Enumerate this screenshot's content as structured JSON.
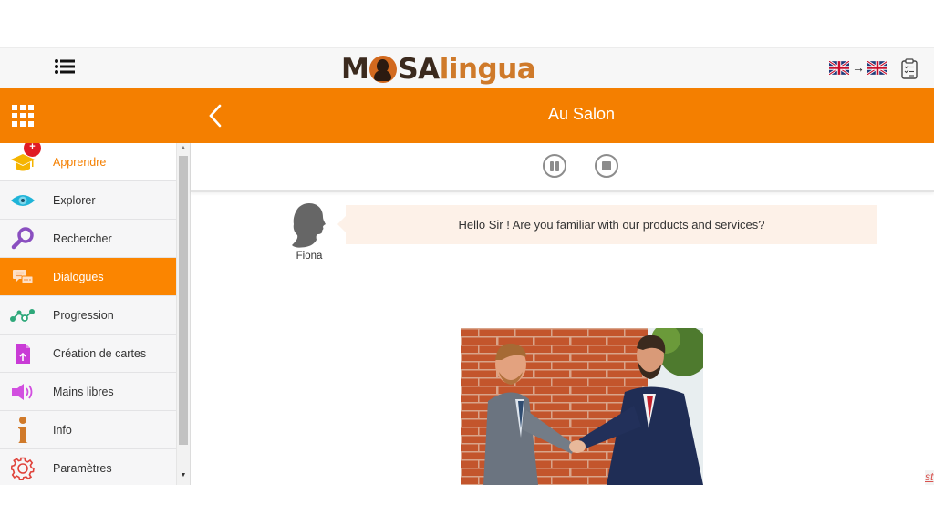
{
  "topbar": {
    "menu_icon": "list-icon",
    "logo": {
      "part1": "M",
      "part2": "SA",
      "part3": "lingua"
    },
    "language_pair": {
      "from": "en-flag-icon",
      "arrow": "→",
      "to": "en-flag-icon"
    },
    "clipboard_icon": "clipboard-checklist-icon"
  },
  "header": {
    "apps_icon": "grid-icon",
    "back_icon": "chevron-left-icon",
    "title": "Au Salon",
    "background": "#f47f00"
  },
  "sidebar": {
    "items": [
      {
        "label": "Apprendre",
        "icon": "graduation-cap-icon",
        "badge": "+",
        "state": "current"
      },
      {
        "label": "Explorer",
        "icon": "eye-icon"
      },
      {
        "label": "Rechercher",
        "icon": "magnifier-icon"
      },
      {
        "label": "Dialogues",
        "icon": "chat-bubbles-icon",
        "state": "active"
      },
      {
        "label": "Progression",
        "icon": "progress-chart-icon"
      },
      {
        "label": "Création de cartes",
        "icon": "card-upload-icon"
      },
      {
        "label": "Mains libres",
        "icon": "speaker-icon"
      },
      {
        "label": "Info",
        "icon": "info-icon"
      },
      {
        "label": "Paramètres",
        "icon": "gear-icon"
      }
    ]
  },
  "player": {
    "pause_icon": "pause-icon",
    "stop_icon": "stop-icon"
  },
  "dialogue": {
    "speaker": "Fiona",
    "line": "Hello Sir ! Are you familiar with our products and services?"
  },
  "scene_image": {
    "description": "Two men in suits shaking hands in front of a brick wall"
  },
  "edge_link": "st"
}
